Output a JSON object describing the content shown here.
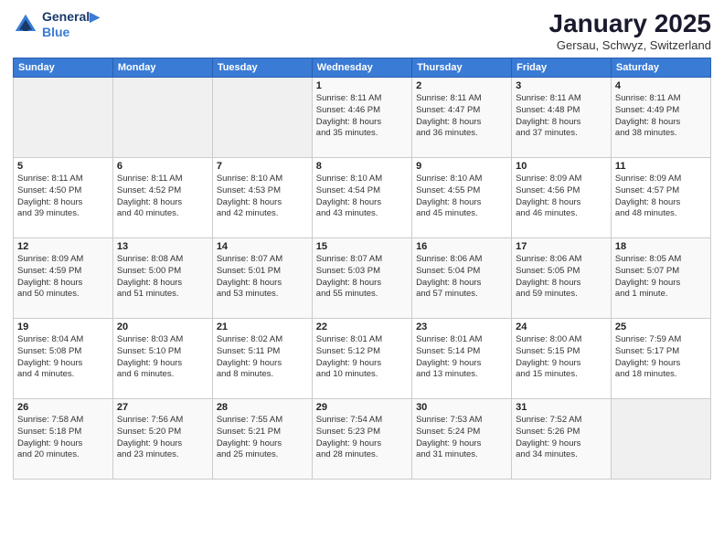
{
  "header": {
    "logo_line1": "General",
    "logo_line2": "Blue",
    "month": "January 2025",
    "location": "Gersau, Schwyz, Switzerland"
  },
  "weekdays": [
    "Sunday",
    "Monday",
    "Tuesday",
    "Wednesday",
    "Thursday",
    "Friday",
    "Saturday"
  ],
  "weeks": [
    [
      {
        "day": "",
        "info": ""
      },
      {
        "day": "",
        "info": ""
      },
      {
        "day": "",
        "info": ""
      },
      {
        "day": "1",
        "info": "Sunrise: 8:11 AM\nSunset: 4:46 PM\nDaylight: 8 hours\nand 35 minutes."
      },
      {
        "day": "2",
        "info": "Sunrise: 8:11 AM\nSunset: 4:47 PM\nDaylight: 8 hours\nand 36 minutes."
      },
      {
        "day": "3",
        "info": "Sunrise: 8:11 AM\nSunset: 4:48 PM\nDaylight: 8 hours\nand 37 minutes."
      },
      {
        "day": "4",
        "info": "Sunrise: 8:11 AM\nSunset: 4:49 PM\nDaylight: 8 hours\nand 38 minutes."
      }
    ],
    [
      {
        "day": "5",
        "info": "Sunrise: 8:11 AM\nSunset: 4:50 PM\nDaylight: 8 hours\nand 39 minutes."
      },
      {
        "day": "6",
        "info": "Sunrise: 8:11 AM\nSunset: 4:52 PM\nDaylight: 8 hours\nand 40 minutes."
      },
      {
        "day": "7",
        "info": "Sunrise: 8:10 AM\nSunset: 4:53 PM\nDaylight: 8 hours\nand 42 minutes."
      },
      {
        "day": "8",
        "info": "Sunrise: 8:10 AM\nSunset: 4:54 PM\nDaylight: 8 hours\nand 43 minutes."
      },
      {
        "day": "9",
        "info": "Sunrise: 8:10 AM\nSunset: 4:55 PM\nDaylight: 8 hours\nand 45 minutes."
      },
      {
        "day": "10",
        "info": "Sunrise: 8:09 AM\nSunset: 4:56 PM\nDaylight: 8 hours\nand 46 minutes."
      },
      {
        "day": "11",
        "info": "Sunrise: 8:09 AM\nSunset: 4:57 PM\nDaylight: 8 hours\nand 48 minutes."
      }
    ],
    [
      {
        "day": "12",
        "info": "Sunrise: 8:09 AM\nSunset: 4:59 PM\nDaylight: 8 hours\nand 50 minutes."
      },
      {
        "day": "13",
        "info": "Sunrise: 8:08 AM\nSunset: 5:00 PM\nDaylight: 8 hours\nand 51 minutes."
      },
      {
        "day": "14",
        "info": "Sunrise: 8:07 AM\nSunset: 5:01 PM\nDaylight: 8 hours\nand 53 minutes."
      },
      {
        "day": "15",
        "info": "Sunrise: 8:07 AM\nSunset: 5:03 PM\nDaylight: 8 hours\nand 55 minutes."
      },
      {
        "day": "16",
        "info": "Sunrise: 8:06 AM\nSunset: 5:04 PM\nDaylight: 8 hours\nand 57 minutes."
      },
      {
        "day": "17",
        "info": "Sunrise: 8:06 AM\nSunset: 5:05 PM\nDaylight: 8 hours\nand 59 minutes."
      },
      {
        "day": "18",
        "info": "Sunrise: 8:05 AM\nSunset: 5:07 PM\nDaylight: 9 hours\nand 1 minute."
      }
    ],
    [
      {
        "day": "19",
        "info": "Sunrise: 8:04 AM\nSunset: 5:08 PM\nDaylight: 9 hours\nand 4 minutes."
      },
      {
        "day": "20",
        "info": "Sunrise: 8:03 AM\nSunset: 5:10 PM\nDaylight: 9 hours\nand 6 minutes."
      },
      {
        "day": "21",
        "info": "Sunrise: 8:02 AM\nSunset: 5:11 PM\nDaylight: 9 hours\nand 8 minutes."
      },
      {
        "day": "22",
        "info": "Sunrise: 8:01 AM\nSunset: 5:12 PM\nDaylight: 9 hours\nand 10 minutes."
      },
      {
        "day": "23",
        "info": "Sunrise: 8:01 AM\nSunset: 5:14 PM\nDaylight: 9 hours\nand 13 minutes."
      },
      {
        "day": "24",
        "info": "Sunrise: 8:00 AM\nSunset: 5:15 PM\nDaylight: 9 hours\nand 15 minutes."
      },
      {
        "day": "25",
        "info": "Sunrise: 7:59 AM\nSunset: 5:17 PM\nDaylight: 9 hours\nand 18 minutes."
      }
    ],
    [
      {
        "day": "26",
        "info": "Sunrise: 7:58 AM\nSunset: 5:18 PM\nDaylight: 9 hours\nand 20 minutes."
      },
      {
        "day": "27",
        "info": "Sunrise: 7:56 AM\nSunset: 5:20 PM\nDaylight: 9 hours\nand 23 minutes."
      },
      {
        "day": "28",
        "info": "Sunrise: 7:55 AM\nSunset: 5:21 PM\nDaylight: 9 hours\nand 25 minutes."
      },
      {
        "day": "29",
        "info": "Sunrise: 7:54 AM\nSunset: 5:23 PM\nDaylight: 9 hours\nand 28 minutes."
      },
      {
        "day": "30",
        "info": "Sunrise: 7:53 AM\nSunset: 5:24 PM\nDaylight: 9 hours\nand 31 minutes."
      },
      {
        "day": "31",
        "info": "Sunrise: 7:52 AM\nSunset: 5:26 PM\nDaylight: 9 hours\nand 34 minutes."
      },
      {
        "day": "",
        "info": ""
      }
    ]
  ]
}
